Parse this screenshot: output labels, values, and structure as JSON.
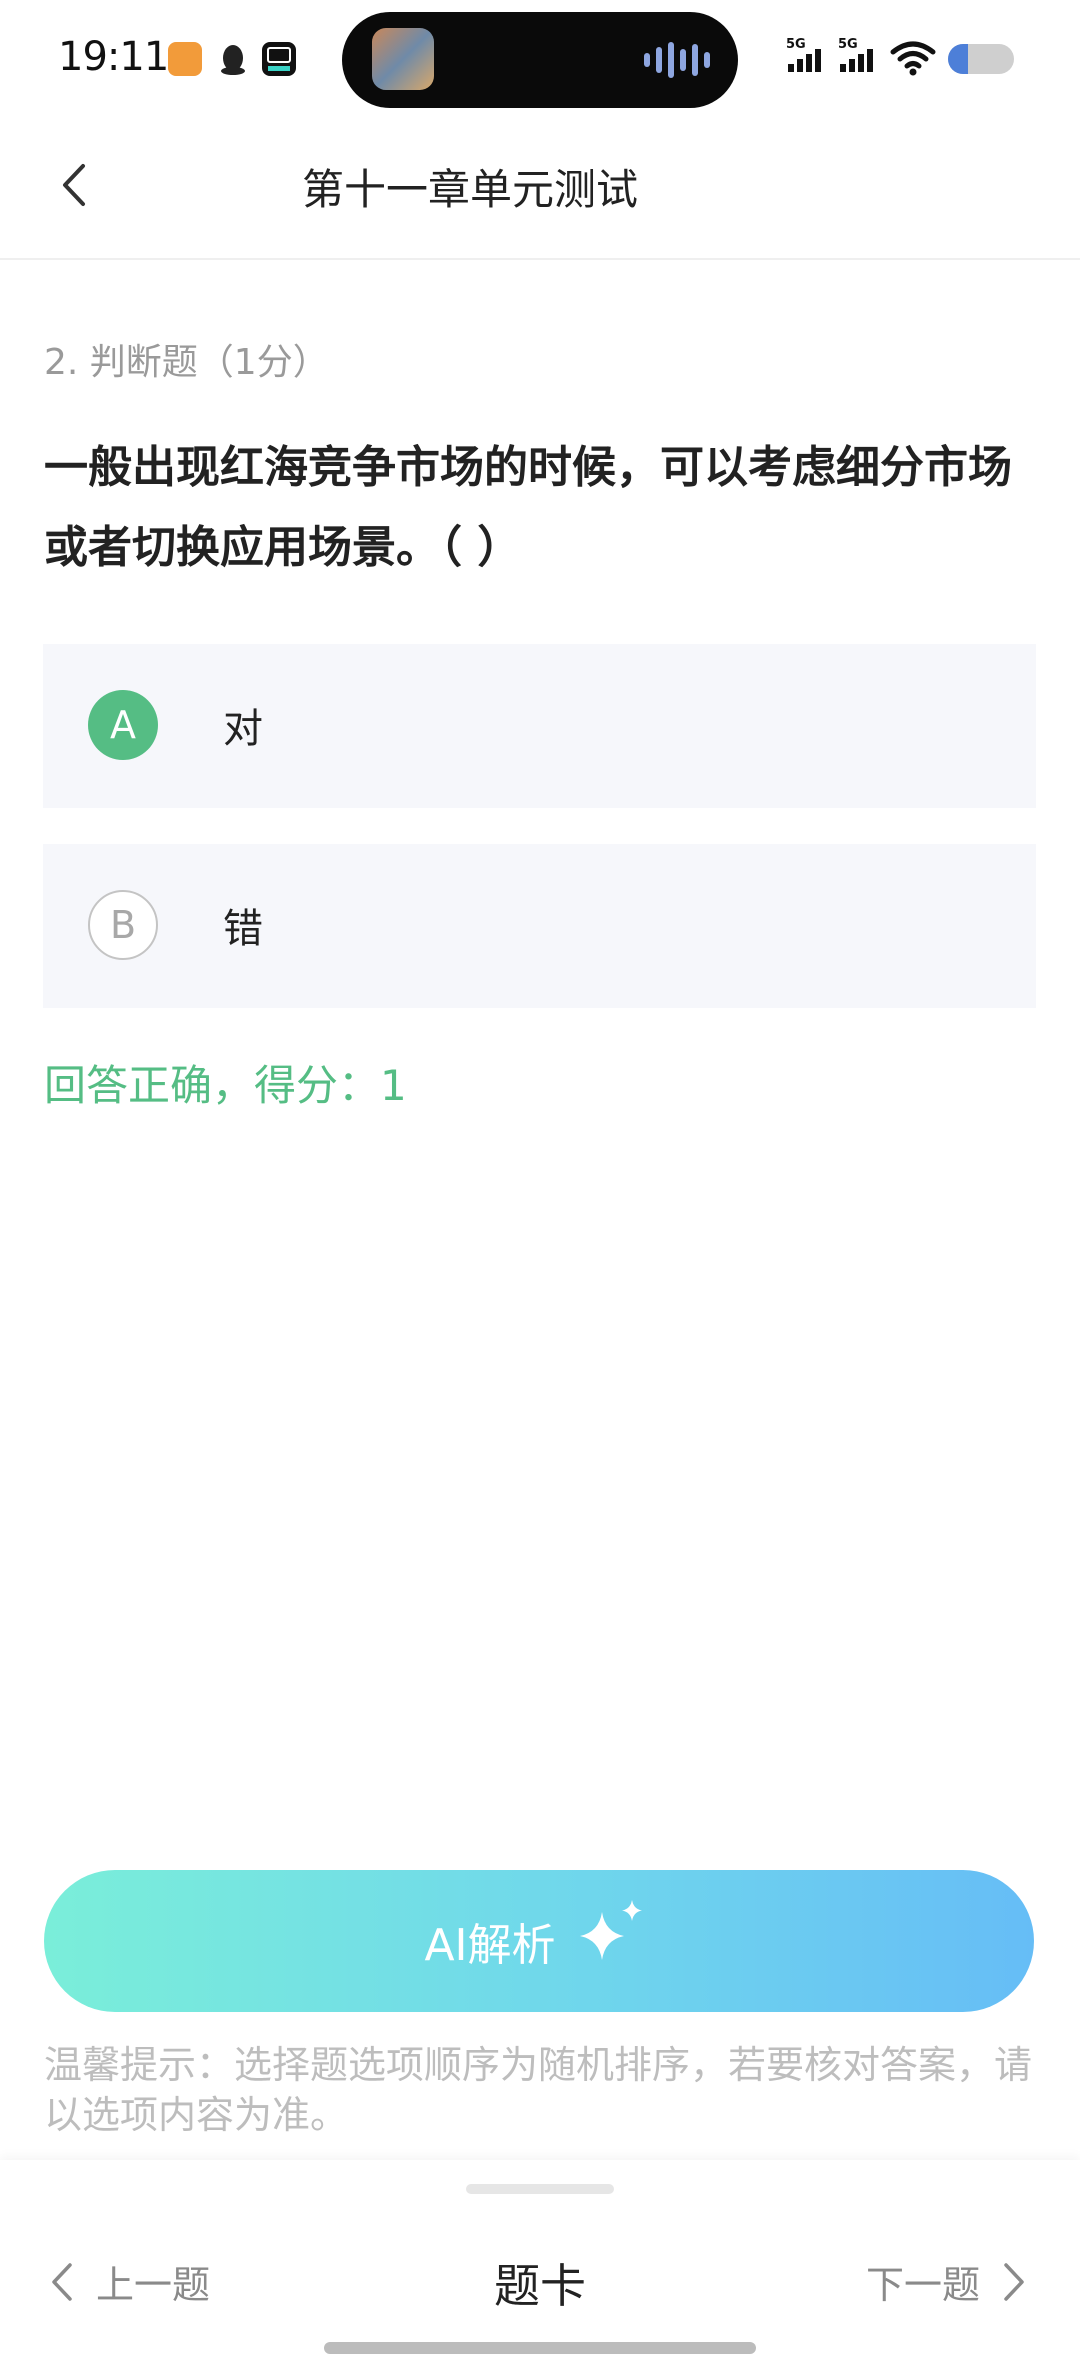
{
  "status_bar": {
    "time": "19:11",
    "signal_1": "5G",
    "signal_2": "5G",
    "battery_level": 0.3
  },
  "header": {
    "title": "第十一章单元测试"
  },
  "question": {
    "meta": "2. 判断题（1分）",
    "text": "一般出现红海竞争市场的时候，可以考虑细分市场或者切换应用场景。（ ）",
    "options": [
      {
        "letter": "A",
        "text": "对",
        "selected": true
      },
      {
        "letter": "B",
        "text": "错",
        "selected": false
      }
    ],
    "result": "回答正确，得分：1"
  },
  "ai_button": {
    "label": "AI解析"
  },
  "tip": "温馨提示：选择题选项顺序为随机排序，若要核对答案，请以选项内容为准。",
  "bottom_nav": {
    "prev_label": "上一题",
    "card_label": "题卡",
    "next_label": "下一题"
  },
  "colors": {
    "correct_green": "#55bd84",
    "ai_gradient_start": "#7aeed9",
    "ai_gradient_end": "#66bdf6"
  }
}
